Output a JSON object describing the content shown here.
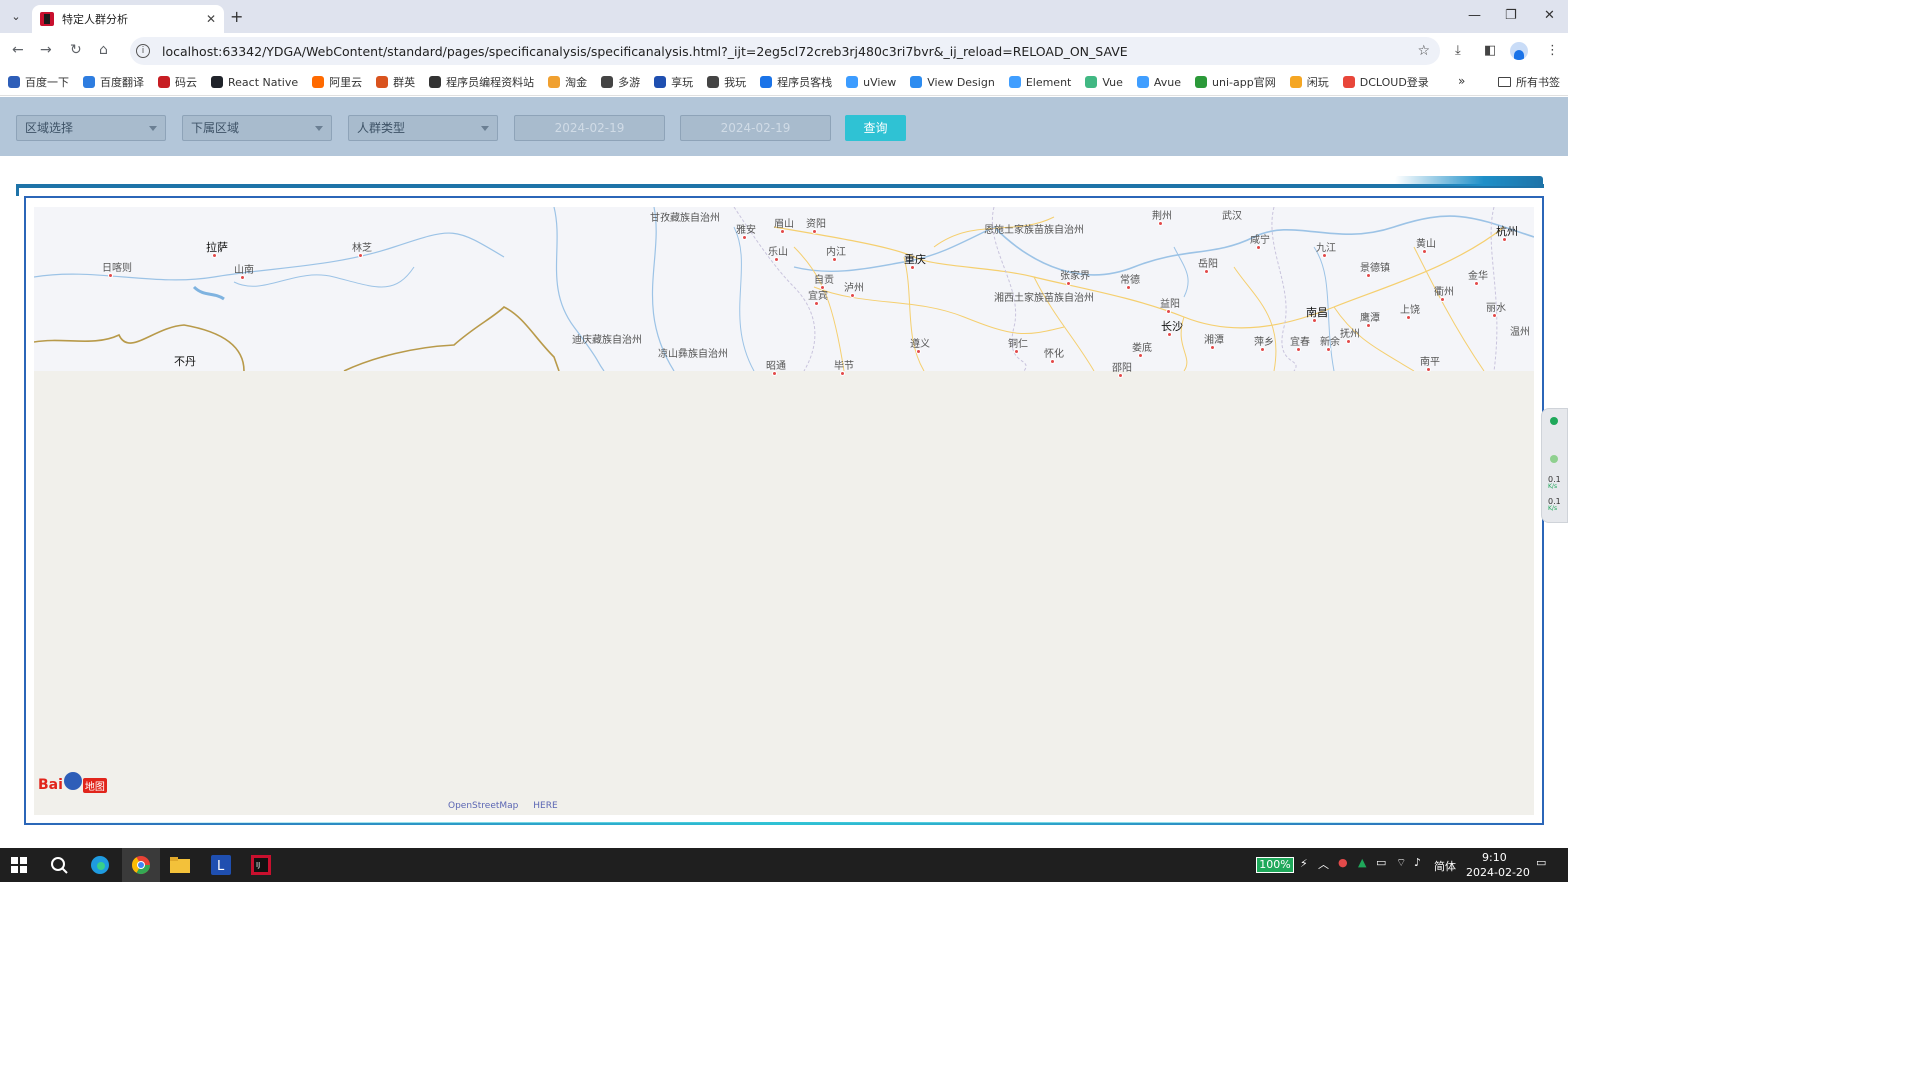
{
  "browser": {
    "tab_title": "特定人群分析",
    "url": "localhost:63342/YDGA/WebContent/standard/pages/specificanalysis/specificanalysis.html?_ijt=2eg5cl72creb3rj480c3ri7bvr&_ij_reload=RELOAD_ON_SAVE",
    "bookmarks": [
      {
        "label": "百度一下",
        "color": "#2e5eb8"
      },
      {
        "label": "百度翻译",
        "color": "#2e7de0"
      },
      {
        "label": "码云",
        "color": "#c71d23"
      },
      {
        "label": "React Native",
        "color": "#20232a"
      },
      {
        "label": "阿里云",
        "color": "#ff6a00"
      },
      {
        "label": "群英",
        "color": "#d9531e"
      },
      {
        "label": "程序员编程资料站",
        "color": "#333333"
      },
      {
        "label": "淘金",
        "color": "#f0a030"
      },
      {
        "label": "多游",
        "color": "#444444"
      },
      {
        "label": "享玩",
        "color": "#1f4fb0"
      },
      {
        "label": "我玩",
        "color": "#444444"
      },
      {
        "label": "程序员客栈",
        "color": "#1a73e8"
      },
      {
        "label": "uView",
        "color": "#3c9cff"
      },
      {
        "label": "View Design",
        "color": "#2d8cf0"
      },
      {
        "label": "Element",
        "color": "#409eff"
      },
      {
        "label": "Vue",
        "color": "#41b883"
      },
      {
        "label": "Avue",
        "color": "#409eff"
      },
      {
        "label": "uni-app官网",
        "color": "#2b9939"
      },
      {
        "label": "闲玩",
        "color": "#f5a623"
      },
      {
        "label": "DCLOUD登录",
        "color": "#e8463a"
      }
    ],
    "all_bookmarks_label": "所有书签"
  },
  "filters": {
    "region_select": "区域选择",
    "sub_region": "下属区域",
    "crowd_type": "人群类型",
    "start_date": "2024-02-19",
    "end_date": "2024-02-19",
    "query_label": "查询"
  },
  "map": {
    "places": [
      {
        "name": "甘孜藏族自治州",
        "big": false
      },
      {
        "name": "拉萨",
        "big": true
      },
      {
        "name": "林芝",
        "big": false
      },
      {
        "name": "日喀则",
        "big": false
      },
      {
        "name": "山南",
        "big": false
      },
      {
        "name": "不丹",
        "big": true
      },
      {
        "name": "雅安",
        "big": false
      },
      {
        "name": "眉山",
        "big": false
      },
      {
        "name": "资阳",
        "big": false
      },
      {
        "name": "乐山",
        "big": false
      },
      {
        "name": "内江",
        "big": false
      },
      {
        "name": "自贡",
        "big": false
      },
      {
        "name": "泸州",
        "big": false
      },
      {
        "name": "宜宾",
        "big": false
      },
      {
        "name": "重庆",
        "big": true
      },
      {
        "name": "恩施土家族苗族自治州",
        "big": false
      },
      {
        "name": "湘西土家族苗族自治州",
        "big": false
      },
      {
        "name": "张家界",
        "big": false
      },
      {
        "name": "常德",
        "big": false
      },
      {
        "name": "益阳",
        "big": false
      },
      {
        "name": "长沙",
        "big": true
      },
      {
        "name": "湘潭",
        "big": false
      },
      {
        "name": "萍乡",
        "big": false
      },
      {
        "name": "宜春",
        "big": false
      },
      {
        "name": "新余",
        "big": false
      },
      {
        "name": "岳阳",
        "big": false
      },
      {
        "name": "咸宁",
        "big": false
      },
      {
        "name": "荆州",
        "big": false
      },
      {
        "name": "武汉",
        "big": false
      },
      {
        "name": "九江",
        "big": false
      },
      {
        "name": "南昌",
        "big": true
      },
      {
        "name": "景德镇",
        "big": false
      },
      {
        "name": "黄山",
        "big": false
      },
      {
        "name": "杭州",
        "big": true
      },
      {
        "name": "金华",
        "big": false
      },
      {
        "name": "衢州",
        "big": false
      },
      {
        "name": "上饶",
        "big": false
      },
      {
        "name": "鹰潭",
        "big": false
      },
      {
        "name": "丽水",
        "big": false
      },
      {
        "name": "抚州",
        "big": false
      },
      {
        "name": "南平",
        "big": false
      },
      {
        "name": "温州",
        "big": false
      },
      {
        "name": "凉山彝族自治州",
        "big": false
      },
      {
        "name": "迪庆藏族自治州",
        "big": false
      },
      {
        "name": "昭通",
        "big": false
      },
      {
        "name": "毕节",
        "big": false
      },
      {
        "name": "遵义",
        "big": false
      },
      {
        "name": "铜仁",
        "big": false
      },
      {
        "name": "怀化",
        "big": false
      },
      {
        "name": "娄底",
        "big": false
      },
      {
        "name": "邵阳",
        "big": false
      }
    ],
    "logo_text": "Bai",
    "logo_map_text": "地图",
    "attribution": [
      "OpenStreetMap",
      "HERE"
    ]
  },
  "side_widget": {
    "upload_value": "0.1",
    "download_value": "0.1",
    "unit": "K/s"
  },
  "taskbar": {
    "battery": "100%",
    "ime": "简体",
    "time": "9:10",
    "date": "2024-02-20"
  }
}
